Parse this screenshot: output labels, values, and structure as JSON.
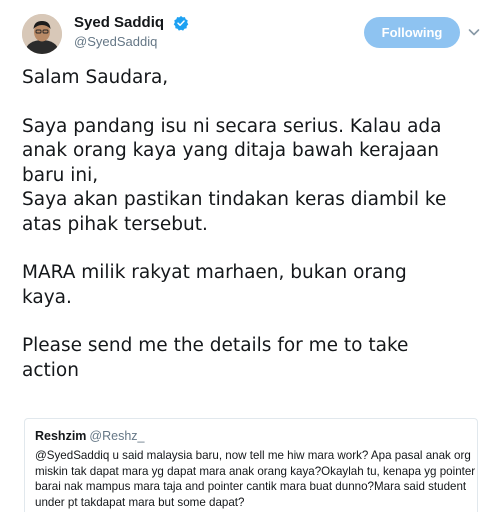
{
  "author": {
    "display_name": "Syed Saddiq",
    "handle": "@SyedSaddiq",
    "verified": true,
    "avatar_icon": "avatar-photo"
  },
  "follow_button": {
    "label": "Following",
    "color": "#8ec3f1"
  },
  "menu_icon": "chevron-down-icon",
  "tweet": {
    "paragraphs": [
      {
        "lines": [
          "Salam Saudara,"
        ]
      },
      {
        "lines": [
          "Saya pandang isu ni secara serius. Kalau ada",
          "anak orang kaya yang ditaja bawah kerajaan",
          "baru ini,",
          "Saya akan pastikan tindakan keras diambil ke",
          "atas pihak tersebut."
        ]
      },
      {
        "lines": [
          "MARA milik rakyat marhaen, bukan orang",
          "kaya."
        ]
      },
      {
        "lines": [
          "Please send me the details for me to take",
          "action"
        ]
      }
    ]
  },
  "quoted_tweet": {
    "display_name": "Reshzim",
    "handle": "@Reshz_",
    "lines": [
      "@SyedSaddiq u said malaysia baru, now tell me hiw mara work? Apa pasal anak org",
      "miskin tak dapat mara yg dapat mara anak orang kaya?Okaylah tu, kenapa yg pointer",
      "barai nak mampus mara taja and pointer cantik mara buat dunno?Mara said student",
      "under pt takdapat mara but some dapat?"
    ]
  },
  "colors": {
    "text": "#14171a",
    "secondary_text": "#657786",
    "verified_blue": "#1da1f2",
    "border": "#e1e8ed"
  }
}
